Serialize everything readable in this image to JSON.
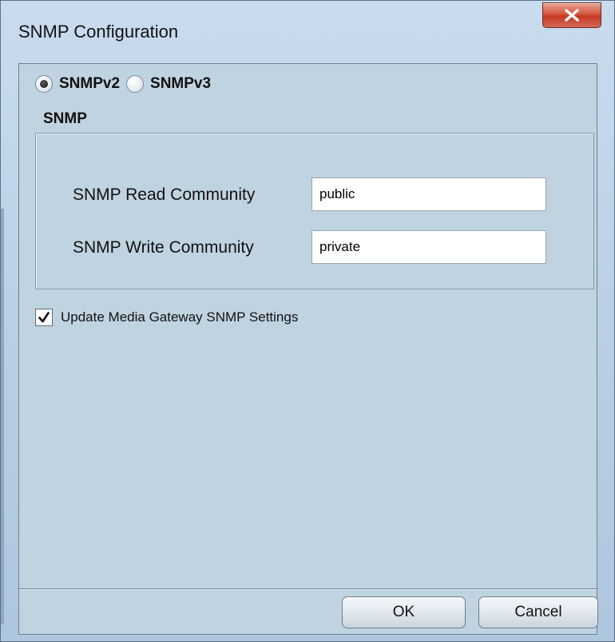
{
  "window": {
    "title": "SNMP Configuration"
  },
  "version": {
    "options": [
      "SNMPv2",
      "SNMPv3"
    ],
    "selected": "SNMPv2"
  },
  "snmp": {
    "section_title": "SNMP",
    "read_label": "SNMP Read Community",
    "read_value": "public",
    "write_label": "SNMP Write Community",
    "write_value": "private"
  },
  "update_gateway": {
    "label": "Update Media Gateway SNMP Settings",
    "checked": true
  },
  "buttons": {
    "ok": "OK",
    "cancel": "Cancel"
  },
  "icons": {
    "close": "close-icon",
    "radio_selected": "radio-selected-icon",
    "radio_unselected": "radio-unselected-icon",
    "checkmark": "checkmark-icon"
  },
  "colors": {
    "window_frame": "#b7cde3",
    "client_background": "#c0d3e1",
    "close_button": "#d3553d"
  }
}
